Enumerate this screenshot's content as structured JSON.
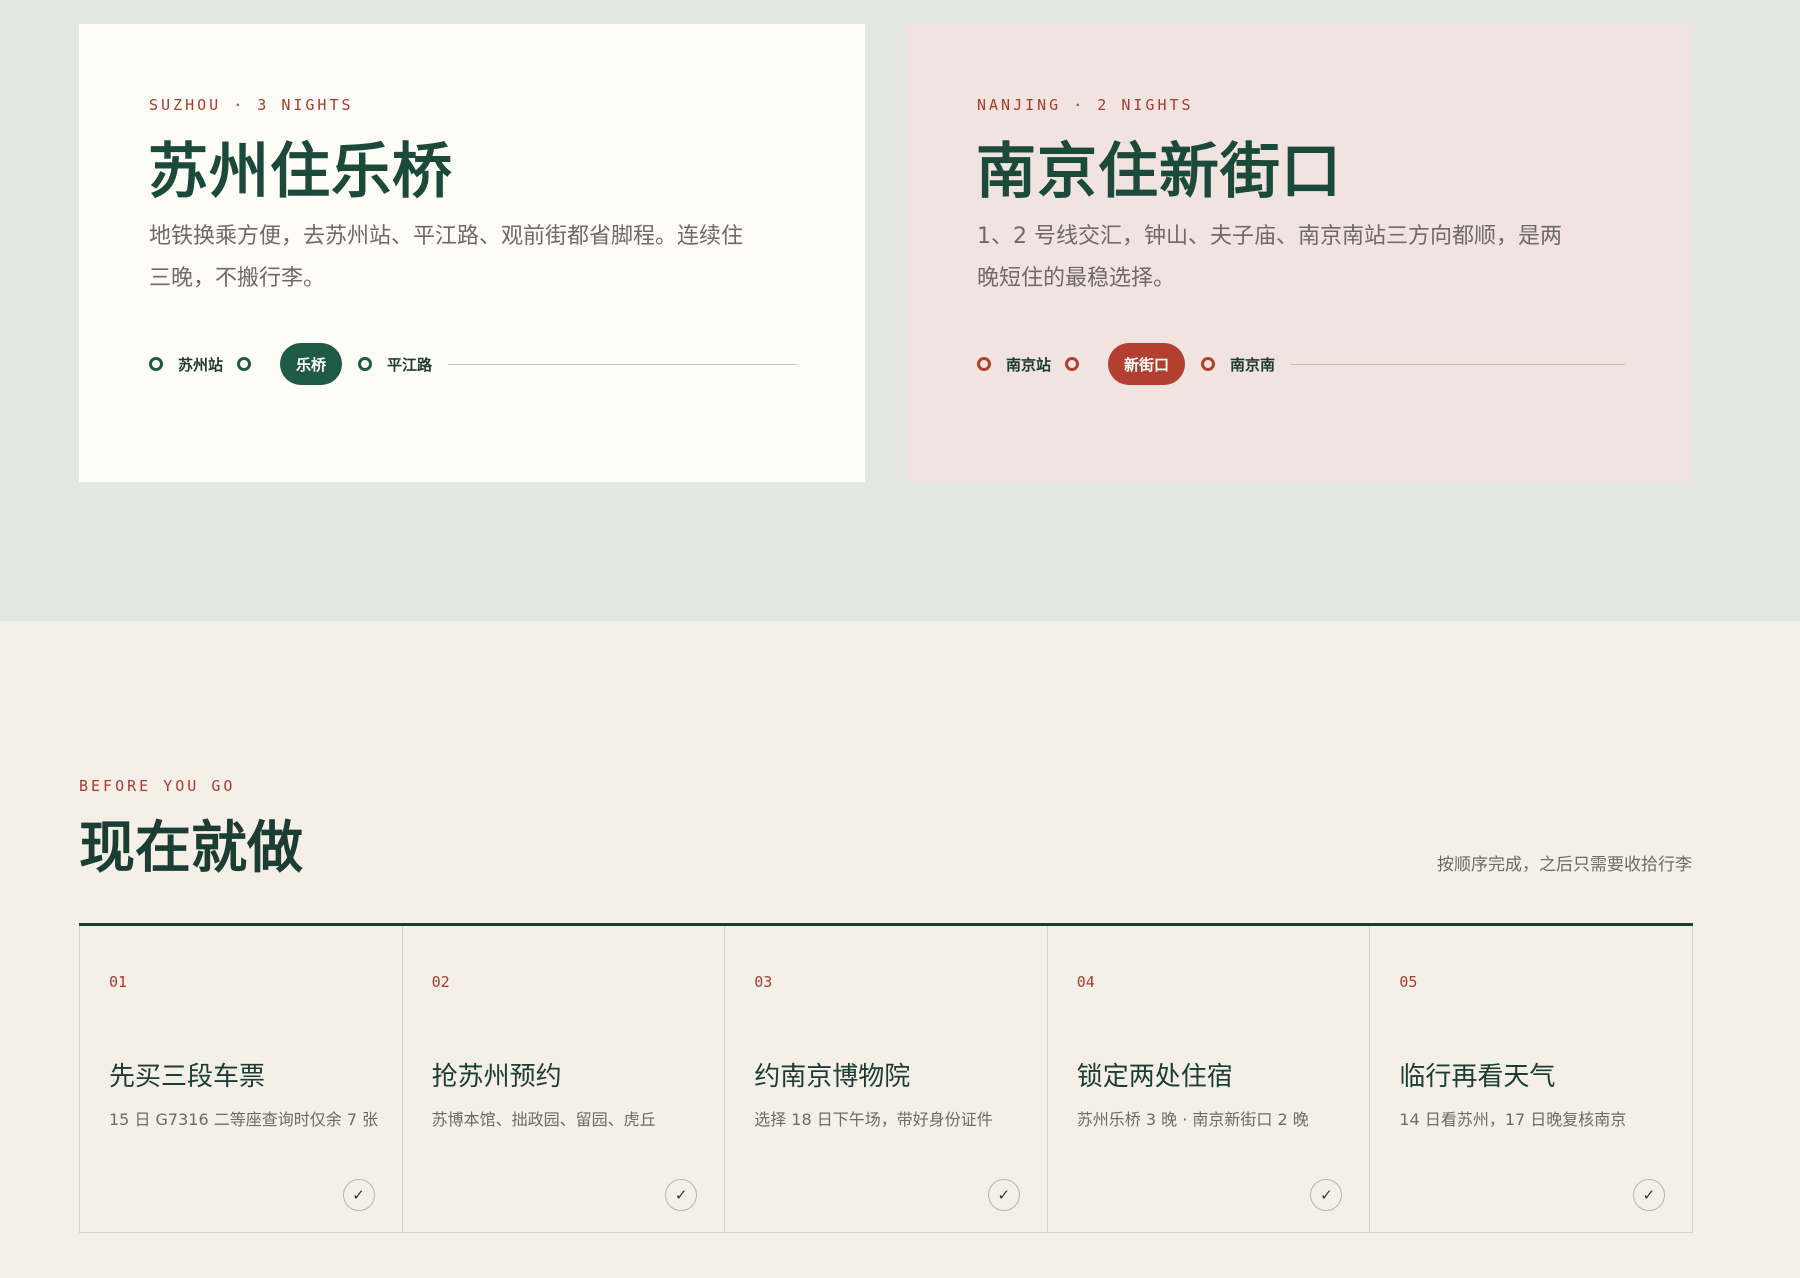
{
  "cards": [
    {
      "kicker": "SUZHOU · 3 NIGHTS",
      "title": "苏州住乐桥",
      "desc": "地铁换乘方便，去苏州站、平江路、观前街都省脚程。连续住三晚，不搬行李。",
      "route": [
        "苏州站",
        "乐桥",
        "平江路"
      ]
    },
    {
      "kicker": "NANJING · 2 NIGHTS",
      "title": "南京住新街口",
      "desc": "1、2 号线交汇，钟山、夫子庙、南京南站三方向都顺，是两晚短住的最稳选择。",
      "route": [
        "南京站",
        "新街口",
        "南京南"
      ]
    }
  ],
  "section": {
    "kicker": "BEFORE YOU GO",
    "title": "现在就做",
    "note": "按顺序完成，之后只需要收拾行李"
  },
  "steps": [
    {
      "num": "01",
      "title": "先买三段车票",
      "desc": "15 日 G7316 二等座查询时仅余 7 张"
    },
    {
      "num": "02",
      "title": "抢苏州预约",
      "desc": "苏博本馆、拙政园、留园、虎丘"
    },
    {
      "num": "03",
      "title": "约南京博物院",
      "desc": "选择 18 日下午场，带好身份证件"
    },
    {
      "num": "04",
      "title": "锁定两处住宿",
      "desc": "苏州乐桥 3 晚 · 南京新街口 2 晚"
    },
    {
      "num": "05",
      "title": "临行再看天气",
      "desc": "14 日看苏州，17 日晚复核南京"
    }
  ],
  "check_glyph": "✓",
  "colors": {
    "green": "#1f5a47",
    "red": "#b23f30",
    "top_bg": "#e3e8e0",
    "bottom_bg": "#f4efe7"
  }
}
